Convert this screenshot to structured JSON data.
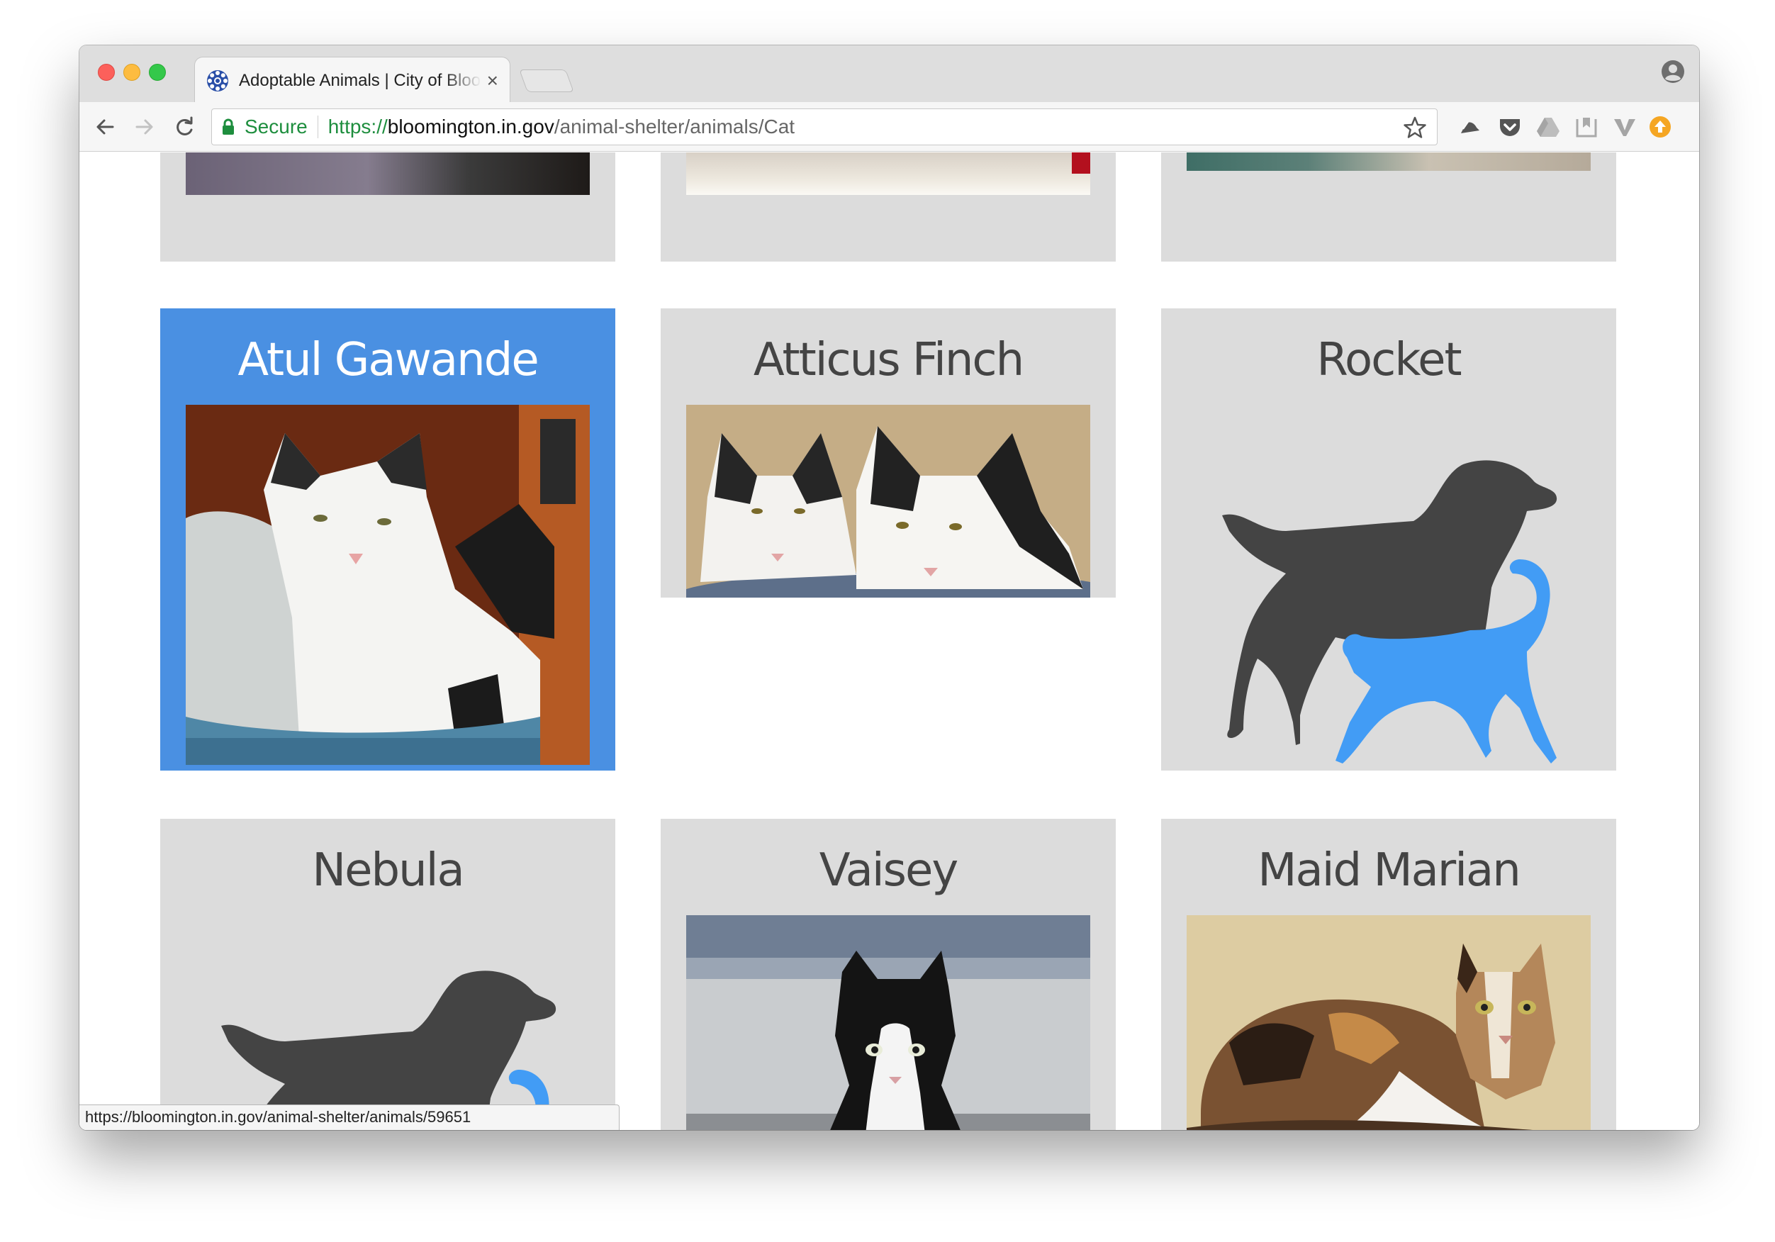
{
  "browser": {
    "tab_title": "Adoptable Animals | City of Bloomington",
    "tab_close": "×",
    "secure_label": "Secure",
    "url_scheme": "https://",
    "url_host": "bloomington.in.gov",
    "url_path": "/animal-shelter/animals/Cat",
    "status_url": "https://bloomington.in.gov/animal-shelter/animals/59651"
  },
  "animals": [
    {
      "name": "Atul Gawande",
      "image": "photo-cat-black-white-in-bin",
      "highlighted": true
    },
    {
      "name": "Atticus Finch",
      "image": "photo-two-cats-in-bin",
      "highlighted": false
    },
    {
      "name": "Rocket",
      "image": "placeholder-dog-cat-silhouette",
      "highlighted": false
    },
    {
      "name": "Nebula",
      "image": "placeholder-dog-cat-silhouette",
      "highlighted": false
    },
    {
      "name": "Vaisey",
      "image": "photo-black-white-kitten",
      "highlighted": false
    },
    {
      "name": "Maid Marian",
      "image": "photo-calico-cat",
      "highlighted": false
    }
  ],
  "colors": {
    "card_bg": "#dcdcdc",
    "card_highlight": "#4a90e2",
    "silhouette_dog": "#444444",
    "silhouette_cat": "#429cf5",
    "secure_green": "#1e8e3e"
  }
}
